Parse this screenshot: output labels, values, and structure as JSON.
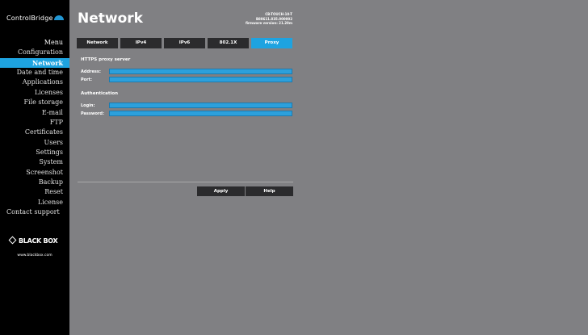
{
  "brand": {
    "logo_text": "ControlBridge"
  },
  "sidebar": {
    "items": [
      {
        "label": "Menu"
      },
      {
        "label": "Configuration"
      },
      {
        "label": "Network"
      },
      {
        "label": "Date and time"
      },
      {
        "label": "Applications"
      },
      {
        "label": "Licenses"
      },
      {
        "label": "File storage"
      },
      {
        "label": "E-mail"
      },
      {
        "label": "FTP"
      },
      {
        "label": "Certificates"
      },
      {
        "label": "Users"
      },
      {
        "label": "Settings"
      },
      {
        "label": "System"
      },
      {
        "label": "Screenshot"
      },
      {
        "label": "Backup"
      },
      {
        "label": "Reset"
      },
      {
        "label": "License"
      },
      {
        "label": "Contact support"
      }
    ],
    "active": "Network"
  },
  "footer_logo": {
    "text": "BLACK BOX",
    "url": "www.blackbox.com"
  },
  "header": {
    "title": "Network",
    "device_model": "CB-TOUCH-10-T",
    "device_serial": "B80611.835.000002",
    "firmware": "firmware version: 21.20m"
  },
  "tabs": [
    {
      "label": "Network"
    },
    {
      "label": "IPv4"
    },
    {
      "label": "IPv6"
    },
    {
      "label": "802.1X"
    },
    {
      "label": "Proxy"
    }
  ],
  "active_tab": "Proxy",
  "proxy": {
    "section_title": "HTTPS proxy server",
    "address_label": "Address:",
    "address_value": "",
    "port_label": "Port:",
    "port_value": ""
  },
  "auth": {
    "section_title": "Authentication",
    "login_label": "Login:",
    "login_value": "",
    "password_label": "Password:",
    "password_value": ""
  },
  "actions": {
    "apply_label": "Apply",
    "help_label": "Help"
  },
  "colors": {
    "accent": "#1ea3e0",
    "field": "#2ca0dc",
    "sidebar_bg": "#000000",
    "content_bg": "#808083",
    "button_bg": "#2b2b2d"
  }
}
